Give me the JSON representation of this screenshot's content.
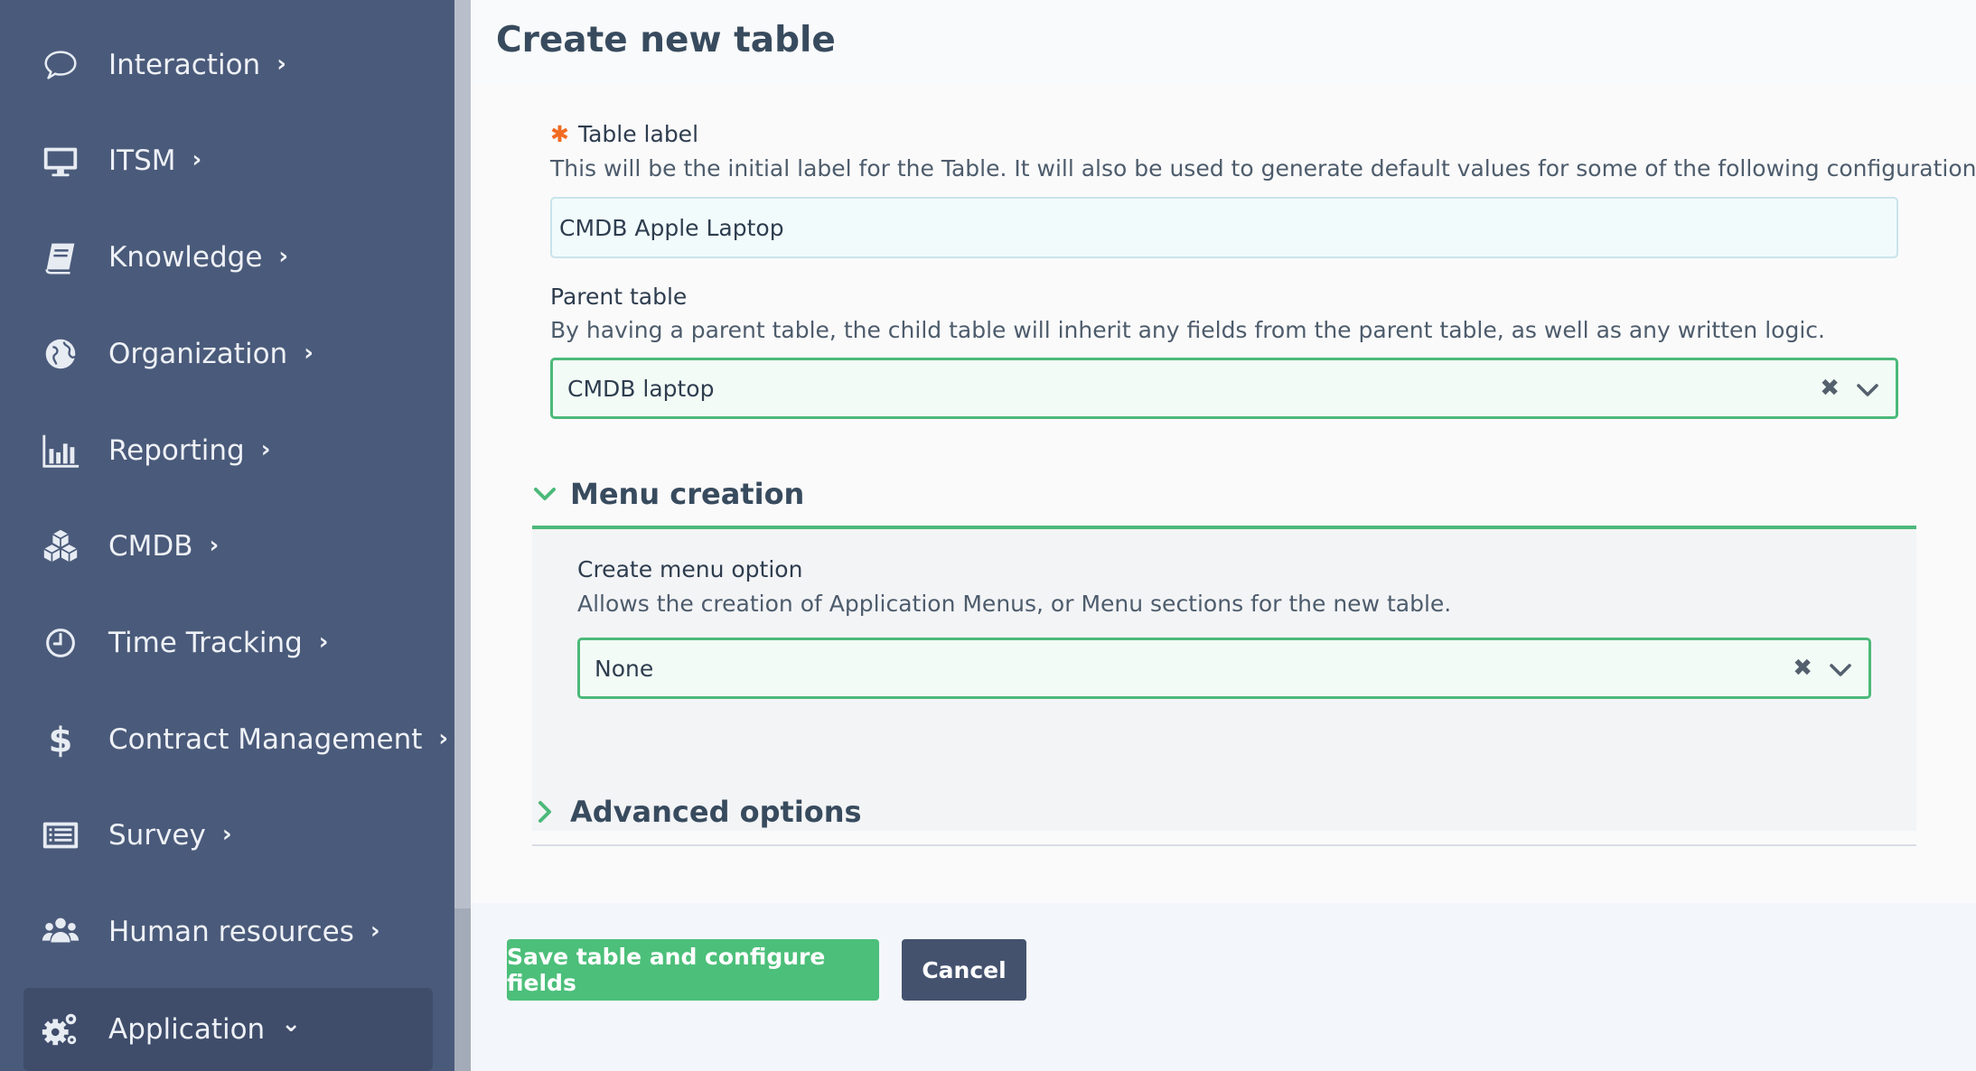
{
  "sidebar": {
    "items": [
      {
        "label": "Interaction",
        "icon": "speech-bubble-icon",
        "chevron": "›"
      },
      {
        "label": "ITSM",
        "icon": "monitor-icon",
        "chevron": "›"
      },
      {
        "label": "Knowledge",
        "icon": "book-icon",
        "chevron": "›"
      },
      {
        "label": "Organization",
        "icon": "globe-icon",
        "chevron": "›"
      },
      {
        "label": "Reporting",
        "icon": "bar-chart-icon",
        "chevron": "›"
      },
      {
        "label": "CMDB",
        "icon": "cubes-icon",
        "chevron": "›"
      },
      {
        "label": "Time Tracking",
        "icon": "clock-icon",
        "chevron": "›"
      },
      {
        "label": "Contract Management",
        "icon": "dollar-icon",
        "chevron": "›"
      },
      {
        "label": "Survey",
        "icon": "list-icon",
        "chevron": "›"
      },
      {
        "label": "Human resources",
        "icon": "users-icon",
        "chevron": "›"
      },
      {
        "label": "Application",
        "icon": "gears-icon",
        "chevron": "⌄",
        "active": true
      }
    ]
  },
  "page": {
    "title": "Create new table"
  },
  "form": {
    "table_label": {
      "required_mark": "✱",
      "label": "Table label",
      "help": "This will be the initial label for the Table. It will also be used to generate default values for some of the following configuration options.",
      "value": "CMDB Apple Laptop"
    },
    "parent_table": {
      "label": "Parent table",
      "help": "By having a parent table, the child table will inherit any fields from the parent table, as well as any written logic.",
      "value": "CMDB laptop",
      "clear_glyph": "✖"
    },
    "menu_creation": {
      "title": "Menu creation",
      "expanded": true,
      "create_menu_option": {
        "label": "Create menu option",
        "help": "Allows the creation of Application Menus, or Menu sections for the new table.",
        "value": "None",
        "clear_glyph": "✖"
      }
    },
    "advanced_options": {
      "title": "Advanced options",
      "expanded": false
    }
  },
  "footer": {
    "save_label": "Save table and configure fields",
    "cancel_label": "Cancel"
  },
  "colors": {
    "sidebar_bg": "#4a5a7a",
    "accent_green": "#4cbf7a",
    "required_orange": "#f26b21",
    "cancel_bg": "#44526e"
  }
}
